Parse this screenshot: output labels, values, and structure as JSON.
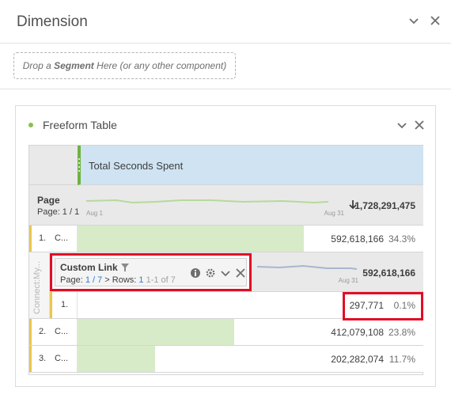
{
  "panel": {
    "title": "Dimension",
    "collapse_icon": "chevron-down-icon",
    "close_icon": "close-icon"
  },
  "dropzone": {
    "prefix": "Drop a ",
    "bold": "Segment",
    "suffix": " Here (or any other component)"
  },
  "card": {
    "title": "Freeform Table",
    "status_color": "#8bbf4f",
    "collapse_icon": "chevron-down-icon",
    "close_icon": "close-icon"
  },
  "table": {
    "metric_header": "Total Seconds Spent",
    "dimension_label": "Page",
    "page_indicator": "Page: 1 / 1",
    "axis_start": "Aug 1",
    "axis_end": "Aug 31",
    "total": "1,728,291,475",
    "sort_icon": "arrow-down-icon",
    "rows": [
      {
        "rank": "1.",
        "name": "C...",
        "value": "592,618,166",
        "pct": "34.3%",
        "fraction": 0.343
      },
      {
        "rank": "2.",
        "name": "C...",
        "value": "412,079,108",
        "pct": "23.8%",
        "fraction": 0.238
      },
      {
        "rank": "3.",
        "name": "C...",
        "value": "202,282,074",
        "pct": "11.7%",
        "fraction": 0.117
      }
    ],
    "breakdown": {
      "parent_label": "Connect:My...",
      "axis_end": "Aug 31",
      "subtotal": "592,618,166",
      "rows": [
        {
          "rank": "1.",
          "value": "297,771",
          "pct": "0.1%"
        }
      ]
    }
  },
  "popup": {
    "title": "Custom Link",
    "filter_icon": "filter-icon",
    "page_label": "Page: ",
    "page_value": "1 / 7",
    "rows_label": " Rows: ",
    "rows_value": "1",
    "range": "1-1 of 7",
    "info_icon": "info-icon",
    "settings_icon": "gear-icon",
    "collapse_icon": "chevron-down-icon",
    "close_icon": "close-icon"
  },
  "colors": {
    "accent_green": "#6fb33f",
    "metric_header_bg": "#cfe3f2",
    "bar_fill": "#d8ebc8",
    "row_accent": "#e9c64f",
    "highlight_red": "#e00d24",
    "link_blue": "#2d79d7"
  }
}
